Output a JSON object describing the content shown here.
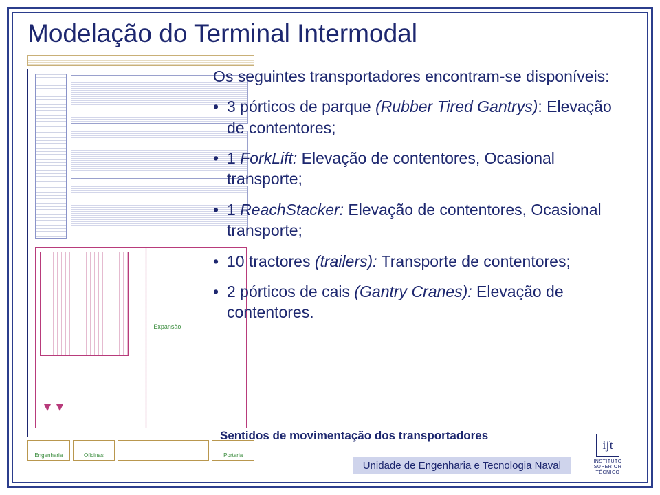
{
  "title": "Modelação do Terminal Intermodal",
  "intro": "Os seguintes transportadores encontram-se disponíveis:",
  "bullets": [
    {
      "count": "3 pórticos de parque ",
      "italic": "(Rubber Tired Gantrys)",
      "tail": ": Elevação de contentores;"
    },
    {
      "count": "1 ",
      "italic": "ForkLift:",
      "tail": " Elevação de contentores, Ocasional transporte;"
    },
    {
      "count": "1 ",
      "italic": "ReachStacker:",
      "tail": " Elevação de contentores, Ocasional transporte;"
    },
    {
      "count": "10 tractores ",
      "italic": "(trailers):",
      "tail": " Transporte de contentores;"
    },
    {
      "count": "2 pórticos de cais ",
      "italic": "(Gantry Cranes):",
      "tail": " Elevação de contentores."
    }
  ],
  "schematic": {
    "yard_label": "Expansão",
    "bottom_boxes": [
      "Engenharia",
      "Oficinas",
      "",
      "Portaria"
    ]
  },
  "caption": "Sentidos de movimentação dos transportadores",
  "footer": "Unidade de Engenharia e Tecnologia Naval",
  "logo": {
    "mark": "iʃt",
    "line1": "INSTITUTO",
    "line2": "SUPERIOR",
    "line3": "TÉCNICO"
  }
}
